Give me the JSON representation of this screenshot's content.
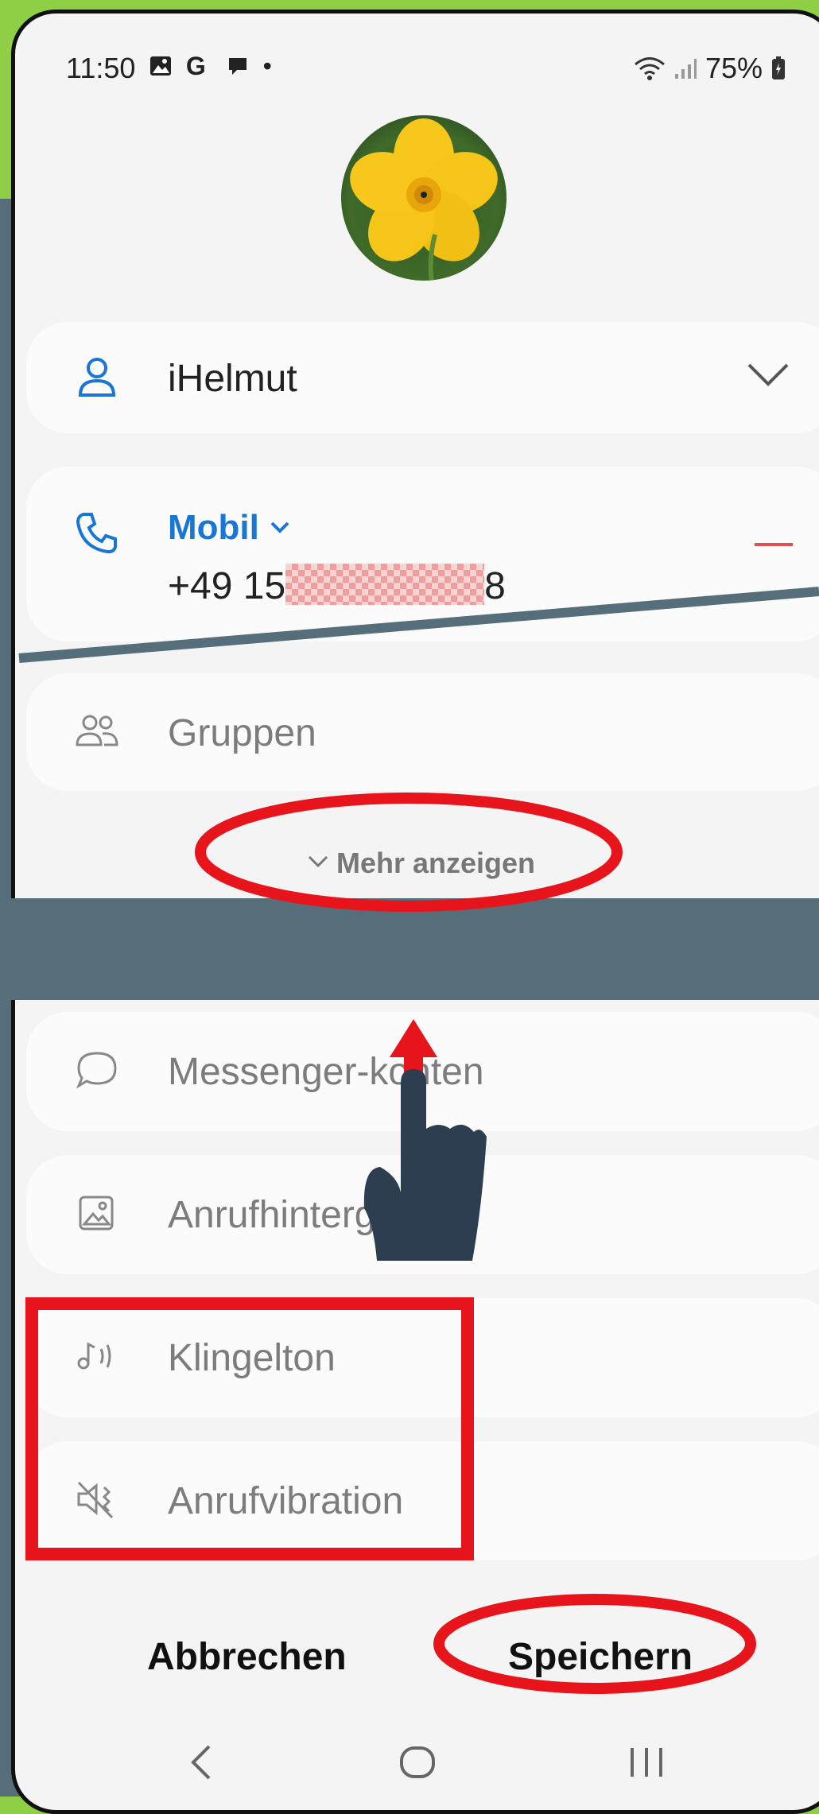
{
  "status_bar": {
    "time": "11:50",
    "notification_letter": "G",
    "dot": "•",
    "battery": "75%"
  },
  "contact": {
    "name": "iHelmut",
    "phone_type": "Mobil",
    "phone_prefix": "+49 15",
    "phone_suffix": "8"
  },
  "fields": {
    "groups": "Gruppen",
    "show_more": "Mehr anzeigen",
    "messenger": "Messenger-konten",
    "call_background": "Anrufhintergrund",
    "ringtone": "Klingelton",
    "vibration": "Anrufvibration"
  },
  "actions": {
    "cancel": "Abbrechen",
    "save": "Speichern"
  },
  "colors": {
    "accent": "#1976d2",
    "annotation_red": "#e8141c",
    "hand": "#2c3e50",
    "slate": "#566d7a"
  },
  "icons": [
    "person-icon",
    "phone-icon",
    "chevron-down-icon",
    "groups-icon",
    "chat-bubble-icon",
    "image-icon",
    "ringtone-icon",
    "vibration-mute-icon",
    "back-icon",
    "home-icon",
    "recents-icon",
    "hand-pointer-icon",
    "arrow-up-icon"
  ]
}
